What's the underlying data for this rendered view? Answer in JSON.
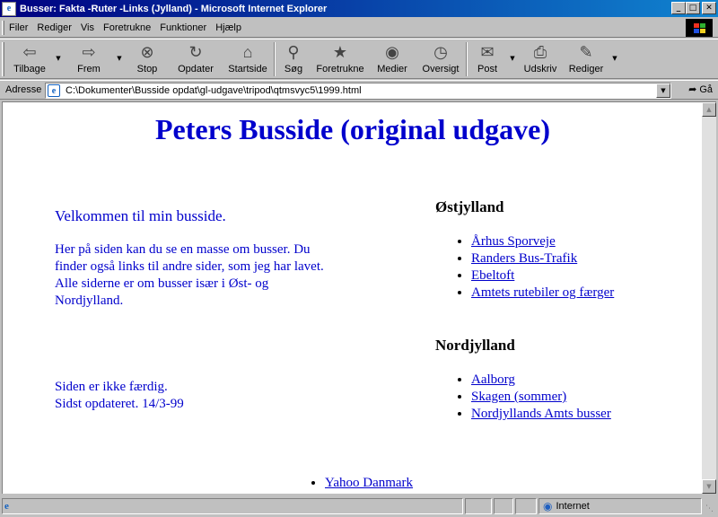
{
  "window": {
    "title": "Busser: Fakta -Ruter -Links (Jylland) - Microsoft Internet Explorer",
    "controls": [
      "minimize",
      "maximize",
      "close"
    ]
  },
  "menu": {
    "items": [
      {
        "label": "Filer",
        "accel": "F"
      },
      {
        "label": "Rediger",
        "accel": "R"
      },
      {
        "label": "Vis",
        "accel": "V"
      },
      {
        "label": "Foretrukne",
        "accel": "t"
      },
      {
        "label": "Funktioner",
        "accel": "k"
      },
      {
        "label": "Hjælp",
        "accel": "H"
      }
    ]
  },
  "toolbar": {
    "back": {
      "label": "Tilbage",
      "icon": "back-arrow-icon"
    },
    "forward": {
      "label": "Frem",
      "icon": "forward-arrow-icon"
    },
    "stop": {
      "label": "Stop",
      "icon": "stop-icon"
    },
    "refresh": {
      "label": "Opdater",
      "icon": "refresh-icon"
    },
    "home": {
      "label": "Startside",
      "icon": "home-icon"
    },
    "search": {
      "label": "Søg",
      "icon": "search-icon"
    },
    "favorites": {
      "label": "Foretrukne",
      "icon": "favorites-icon"
    },
    "media": {
      "label": "Medier",
      "icon": "media-icon"
    },
    "history": {
      "label": "Oversigt",
      "icon": "history-icon"
    },
    "mail": {
      "label": "Post",
      "icon": "mail-icon"
    },
    "print": {
      "label": "Udskriv",
      "icon": "print-icon"
    },
    "edit": {
      "label": "Rediger",
      "icon": "edit-icon"
    }
  },
  "address": {
    "label": "Adresse",
    "url": "C:\\Dokumenter\\Busside opdat\\gl-udgave\\tripod\\qtmsvyc5\\1999.html",
    "go_label": "Gå"
  },
  "page": {
    "heading": "Peters Busside (original udgave)",
    "welcome": "Velkommen til min busside.",
    "intro": "Her på siden kan du se en masse om busser. Du finder også links til andre sider, som jeg har lavet. Alle siderne er om busser især i Øst- og Nordjylland.",
    "status_line1": "Siden er ikke færdig.",
    "status_line2": "Sidst opdateret. 14/3-99",
    "regions": [
      {
        "title": "Østjylland",
        "links": [
          "Århus Sporveje",
          "Randers Bus-Trafik",
          "Ebeltoft",
          "Amtets rutebiler og færger"
        ]
      },
      {
        "title": "Nordjylland",
        "links": [
          "Aalborg",
          "Skagen (sommer)",
          "Nordjyllands Amts busser"
        ]
      }
    ],
    "bottom_link": "Yahoo Danmark"
  },
  "statusbar": {
    "zone": "Internet"
  },
  "colors": {
    "titlebar_start": "#000080",
    "titlebar_end": "#1084d0",
    "page_text": "#0000cc",
    "chrome": "#c0c0c0"
  }
}
